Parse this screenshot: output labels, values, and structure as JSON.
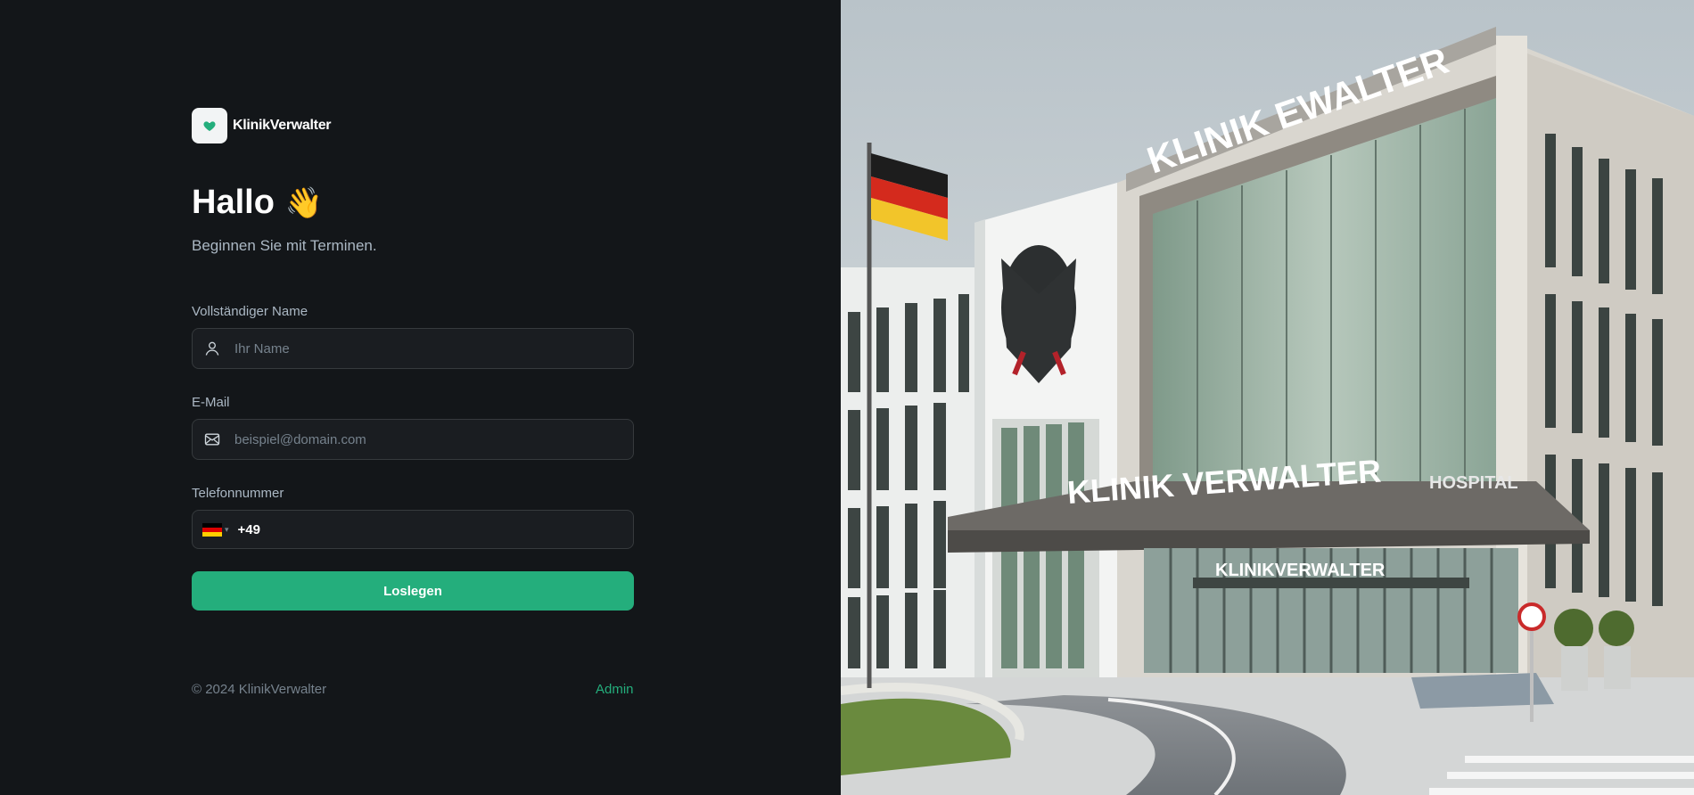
{
  "brand": {
    "name": "KlinikVerwalter",
    "logo_icon": "heart-icon",
    "accent": "#24AE7C"
  },
  "hero": {
    "title": "Hallo",
    "emoji": "👋",
    "subtitle": "Beginnen Sie mit Terminen."
  },
  "form": {
    "name": {
      "label": "Vollständiger Name",
      "placeholder": "Ihr Name",
      "icon": "user-icon"
    },
    "email": {
      "label": "E-Mail",
      "placeholder": "beispiel@domain.com",
      "icon": "mail-icon"
    },
    "phone": {
      "label": "Telefonnummer",
      "country": "DE",
      "value": "+49"
    },
    "submit_label": "Loslegen"
  },
  "footer": {
    "copyright": "© 2024 KlinikVerwalter",
    "admin_link": "Admin"
  },
  "image": {
    "sign_roof": "KLINIK EWALTER",
    "sign_main": "KLINIK VERWALTER",
    "sign_side": "HOSPITAL",
    "sign_entrance": "KLINIKVERWALTER"
  }
}
